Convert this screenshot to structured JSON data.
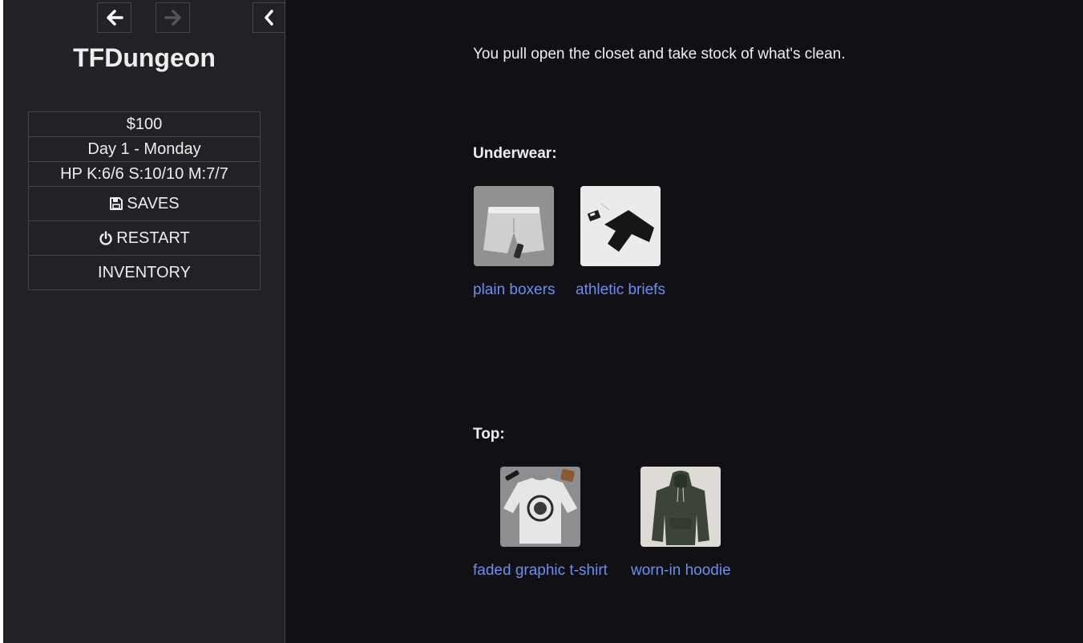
{
  "sidebar": {
    "title": "TFDungeon",
    "stats": {
      "money": "$100",
      "day": "Day 1 - Monday",
      "hp": "HP K:6/6 S:10/10 M:7/7"
    },
    "buttons": {
      "saves": "SAVES",
      "restart": "RESTART",
      "inventory": "INVENTORY"
    }
  },
  "passage": {
    "intro": "You pull open the closet and take stock of what's clean.",
    "underwear": {
      "label": "Underwear:",
      "items": [
        {
          "name": "plain boxers",
          "image": "gray-boxers-photo"
        },
        {
          "name": "athletic briefs",
          "image": "black-briefs-photo"
        }
      ]
    },
    "top": {
      "label": "Top:",
      "items": [
        {
          "name": "faded graphic t-shirt",
          "image": "white-graphic-shirt-photo"
        },
        {
          "name": "worn-in hoodie",
          "image": "green-hoodie-photo"
        }
      ]
    }
  },
  "colors": {
    "background": "#111014",
    "sidebar": "#222125",
    "link": "#6b8ef0"
  }
}
